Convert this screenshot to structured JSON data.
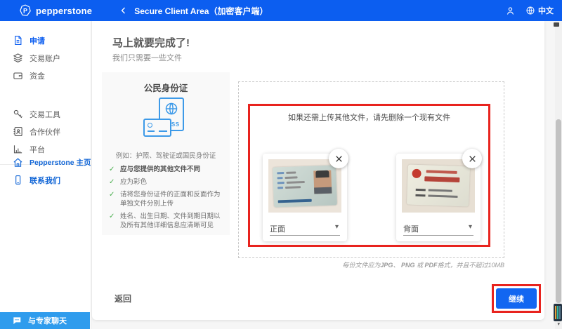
{
  "colors": {
    "header_blue": "#0c5ef0",
    "accent_blue": "#1266f1",
    "chat_blue": "#2f9ced",
    "alert_red": "#e8231e",
    "check_green": "#4caf50",
    "doc_icon_blue": "#3d9ae8"
  },
  "header": {
    "logo_text": "pepperstone",
    "title": "Secure Client Area（加密客户端）",
    "language_label": "中文"
  },
  "sidebar": {
    "items": [
      {
        "label": "申请",
        "icon": "document-icon",
        "active": true
      },
      {
        "label": "交易账户",
        "icon": "layers-icon",
        "active": false
      },
      {
        "label": "资金",
        "icon": "wallet-icon",
        "active": false
      },
      {
        "label": "交易工具",
        "icon": "key-icon",
        "active": false
      },
      {
        "label": "合作伙伴",
        "icon": "contacts-icon",
        "active": false
      },
      {
        "label": "平台",
        "icon": "bar-chart-icon",
        "active": false
      }
    ],
    "footer_items": [
      {
        "label": "Pepperstone 主页",
        "icon": "home-icon"
      },
      {
        "label": "联系我们",
        "icon": "phone-icon"
      }
    ],
    "chat_label": "与专家聊天"
  },
  "main": {
    "title": "马上就要完成了!",
    "subtitle": "我们只需要一些文件",
    "doc_panel": {
      "heading": "公民身份证",
      "pass_label": "PASS",
      "example": "例如：护照、驾驶证或国民身份证",
      "checklist": [
        {
          "text": "应与您提供的其他文件不同"
        },
        {
          "text": "应为彩色"
        },
        {
          "text": "请将您身份证件的正面和反面作为单独文件分别上传"
        },
        {
          "text": "姓名、出生日期、文件到期日期以及所有其他详细信息应清晰可见"
        }
      ]
    },
    "upload": {
      "warning": "如果还需上传其他文件，请先删除一个现有文件",
      "files": [
        {
          "side_label": "正面"
        },
        {
          "side_label": "背面"
        }
      ],
      "format_note": {
        "p1": "每份文件应为",
        "jpg": "JPG",
        "s1": "、 ",
        "png": "PNG",
        "s2": " 或 ",
        "pdf": "PDF",
        "p2": "格式，并且不超过10MB"
      }
    },
    "footer": {
      "back_label": "返回",
      "continue_label": "继续"
    }
  }
}
